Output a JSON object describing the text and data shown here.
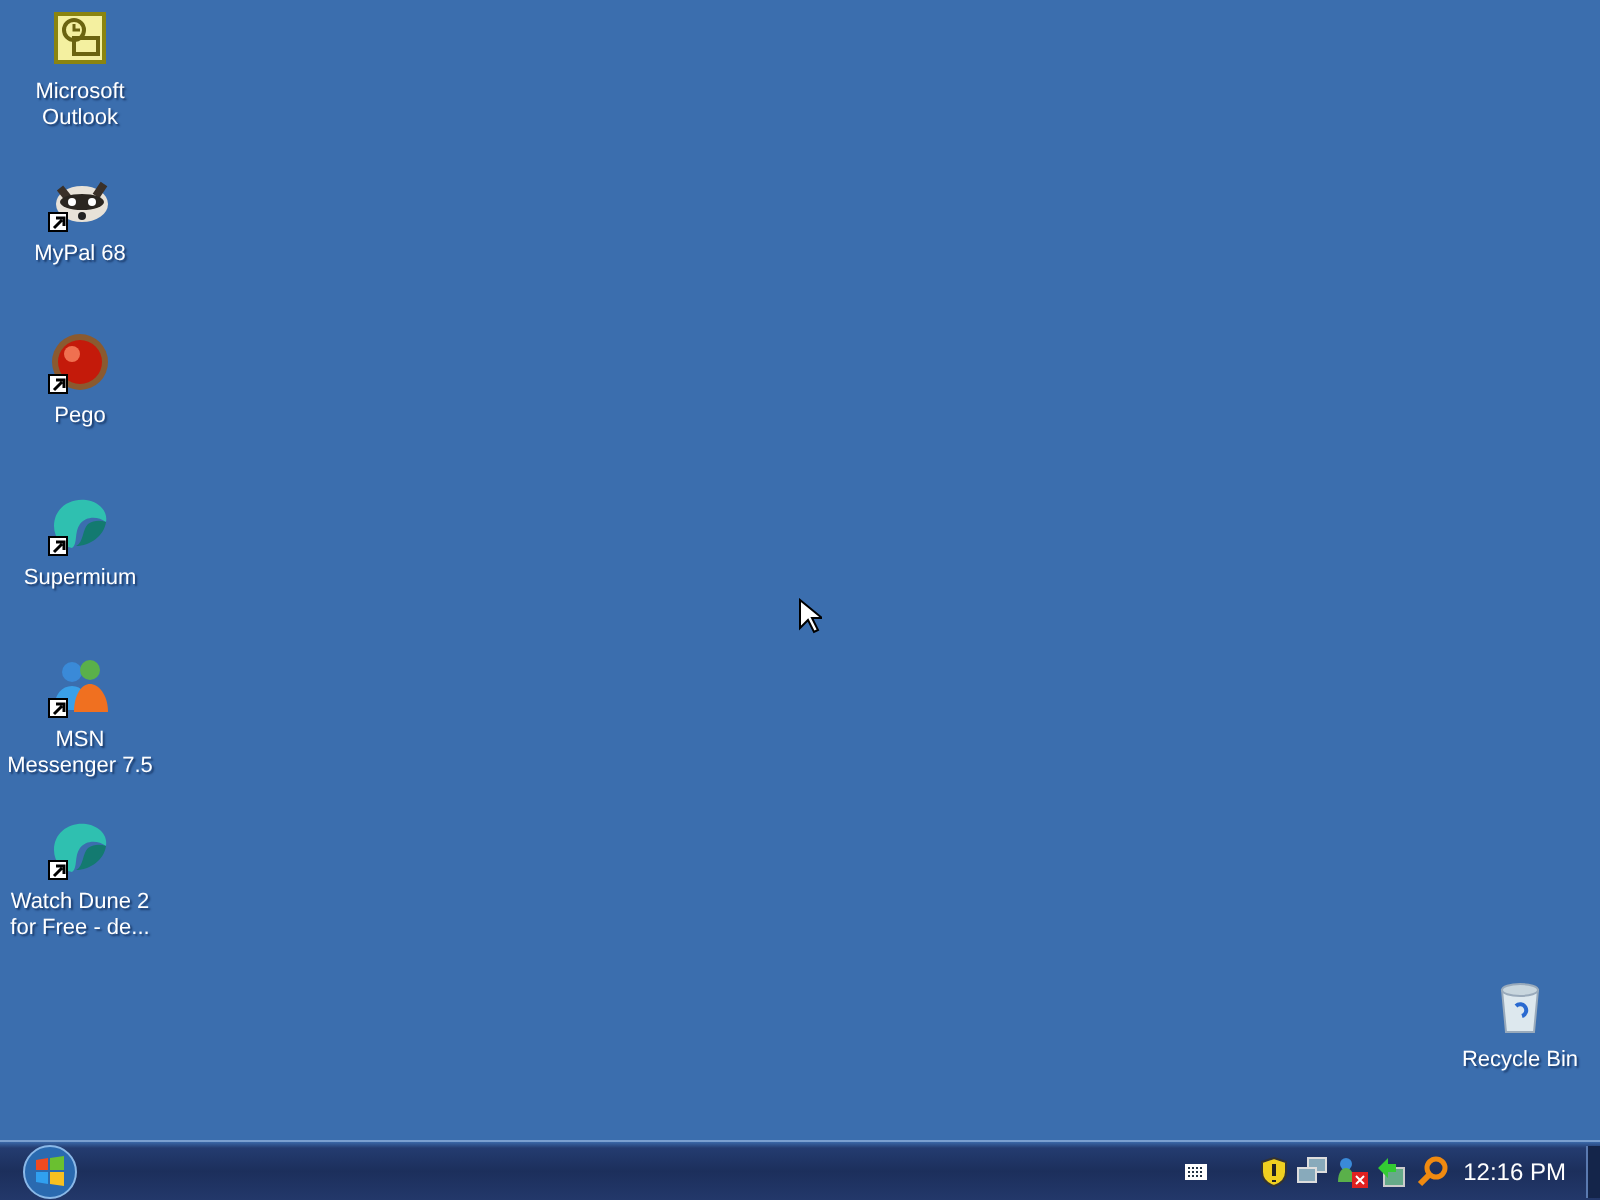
{
  "desktop_icons": [
    {
      "label": "Microsoft Outlook",
      "kind": "outlook",
      "shortcut": false
    },
    {
      "label": "MyPal 68",
      "kind": "raccoon",
      "shortcut": true
    },
    {
      "label": "Pego",
      "kind": "redball",
      "shortcut": true
    },
    {
      "label": "Supermium",
      "kind": "teal",
      "shortcut": true
    },
    {
      "label": "MSN Messenger 7.5",
      "kind": "msn",
      "shortcut": true
    },
    {
      "label": "Watch Dune 2 for Free - de...",
      "kind": "teal",
      "shortcut": true
    }
  ],
  "recycle_bin": {
    "label": "Recycle Bin",
    "shortcut": false
  },
  "taskbar": {
    "clock": "12:16 PM"
  }
}
